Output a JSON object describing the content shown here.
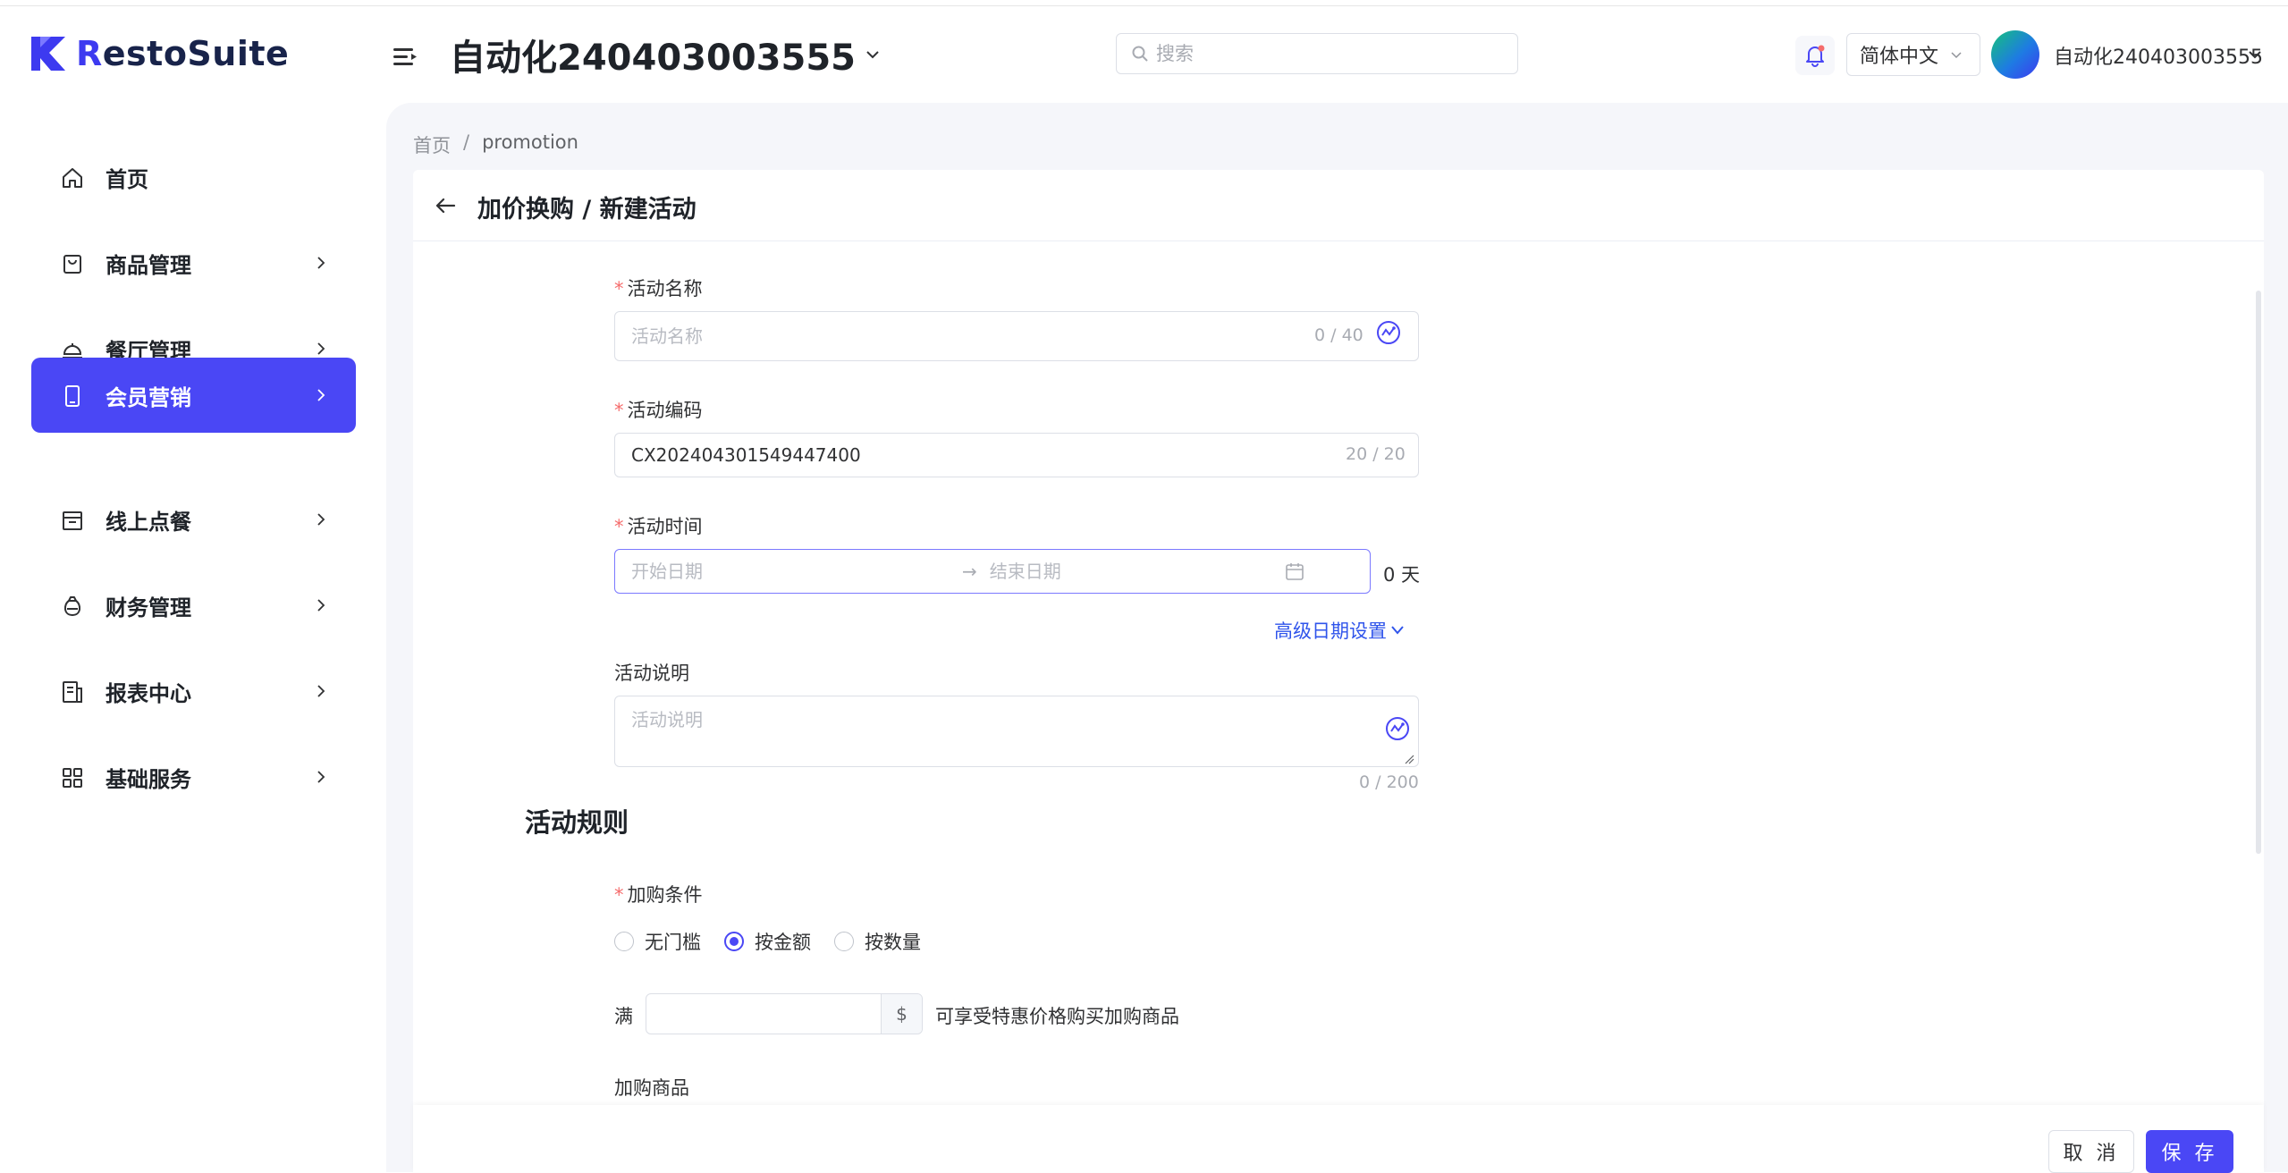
{
  "brand": {
    "name_r": "R",
    "name_rest": "estoSuite"
  },
  "header": {
    "store_title": "自动化240403003555",
    "search_placeholder": "搜索",
    "language": "简体中文",
    "user_name": "自动化240403003555"
  },
  "sidebar": {
    "items": [
      {
        "label": "首页",
        "icon": "home-icon"
      },
      {
        "label": "商品管理",
        "icon": "shopping-bag-icon"
      },
      {
        "label": "餐厅管理",
        "icon": "service-bell-icon"
      },
      {
        "label": "会员营销",
        "icon": "mobile-icon",
        "active": true
      },
      {
        "label": "线上点餐",
        "icon": "store-icon"
      },
      {
        "label": "财务管理",
        "icon": "money-bag-icon"
      },
      {
        "label": "报表中心",
        "icon": "report-icon"
      },
      {
        "label": "基础服务",
        "icon": "grid-icon"
      }
    ]
  },
  "breadcrumb": {
    "home": "首页",
    "sep": "/",
    "current": "promotion"
  },
  "page": {
    "title": "加价换购 / 新建活动"
  },
  "form": {
    "name": {
      "label": "活动名称",
      "placeholder": "活动名称",
      "value": "",
      "counter": "0 / 40"
    },
    "code": {
      "label": "活动编码",
      "value": "CX202404301549447400",
      "counter": "20 / 20"
    },
    "time": {
      "label": "活动时间",
      "start_placeholder": "开始日期",
      "end_placeholder": "结束日期",
      "arrow": "→",
      "days": "0 天"
    },
    "advanced_link": "高级日期设置",
    "desc": {
      "label": "活动说明",
      "placeholder": "活动说明",
      "counter": "0 / 200"
    }
  },
  "rules": {
    "section_title": "活动规则",
    "condition_label": "加购条件",
    "options": [
      {
        "label": "无门槛",
        "checked": false
      },
      {
        "label": "按金额",
        "checked": true
      },
      {
        "label": "按数量",
        "checked": false
      }
    ],
    "threshold_prefix": "满",
    "currency": "$",
    "threshold_suffix": "可享受特惠价格购买加购商品",
    "products_label": "加购商品"
  },
  "footer": {
    "cancel_label": "取 消",
    "save_label": "保 存"
  },
  "colors": {
    "primary": "#4a47f5",
    "required": "#f56c6c",
    "link": "#2f54eb"
  }
}
